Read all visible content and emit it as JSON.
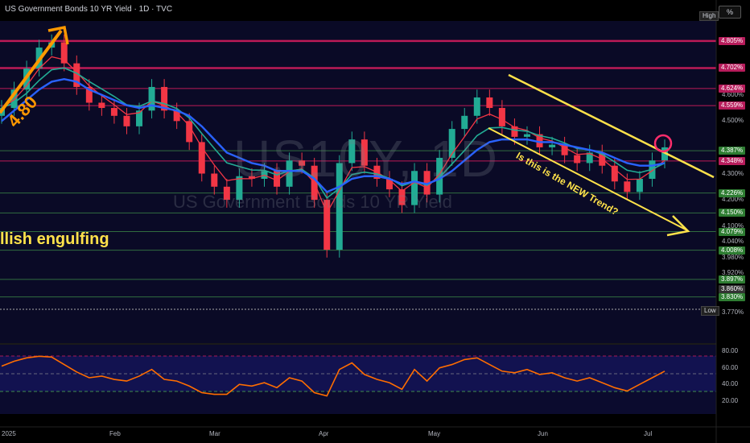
{
  "header": {
    "title": "US Government Bonds 10 YR Yield · 1D · TVC"
  },
  "toolbar": {
    "scale_label": "%",
    "high_label": "High",
    "low_label": "Low"
  },
  "watermark": {
    "symbol": "US10Y, 1D",
    "name": "US Government Bonds 10 YR Yield"
  },
  "annotations": {
    "trend_question": "Is this is the NEW Trend?",
    "pattern": "llish engulfing",
    "level_label": "4.80"
  },
  "colors": {
    "up": "#22ab94",
    "down": "#f23645",
    "ema_fast": "#f23645",
    "ema_mid": "#22ab94",
    "ema_slow": "#2962ff",
    "trendline": "#ffe24a",
    "level_magenta": "#e91e63",
    "level_green": "#4caf50",
    "rsi_line": "#ff6d00",
    "arrow_orange": "#ff9800"
  },
  "price_axis": [
    "4.600%",
    "4.500%",
    "4.300%",
    "4.200%",
    "4.100%",
    "4.040%",
    "3.980%",
    "3.920%",
    "3.770%"
  ],
  "rsi_axis": [
    "80.00",
    "60.00",
    "40.00",
    "20.00"
  ],
  "date_axis": [
    "2025",
    "Feb",
    "Mar",
    "Apr",
    "May",
    "Jun",
    "Jul"
  ],
  "price_tags": [
    {
      "label": "4.805%",
      "price": 4.805,
      "color": "#b71c5b"
    },
    {
      "label": "4.702%",
      "price": 4.702,
      "color": "#b71c5b"
    },
    {
      "label": "4.624%",
      "price": 4.624,
      "color": "#b71c5b"
    },
    {
      "label": "4.559%",
      "price": 4.559,
      "color": "#b71c5b"
    },
    {
      "label": "4.387%",
      "price": 4.387,
      "color": "#2e7d32"
    },
    {
      "label": "4.348%",
      "price": 4.348,
      "color": "#b71c5b"
    },
    {
      "label": "4.226%",
      "price": 4.226,
      "color": "#2e7d32"
    },
    {
      "label": "4.150%",
      "price": 4.15,
      "color": "#2e7d32"
    },
    {
      "label": "4.079%",
      "price": 4.079,
      "color": "#2e7d32"
    },
    {
      "label": "4.008%",
      "price": 4.008,
      "color": "#2e7d32"
    },
    {
      "label": "3.897%",
      "price": 3.897,
      "color": "#2e7d32"
    },
    {
      "label": "3.860%",
      "price": 3.86,
      "color": "#333333"
    },
    {
      "label": "3.830%",
      "price": 3.83,
      "color": "#2e7d32"
    }
  ],
  "chart_data": {
    "type": "line",
    "title": "US Government Bonds 10 YR Yield · 1D · TVC",
    "ylim": [
      3.74,
      4.86
    ],
    "x": [
      "Jan",
      "Jan",
      "Jan",
      "Jan",
      "Jan",
      "Jan",
      "Jan",
      "Jan",
      "Jan",
      "Feb",
      "Feb",
      "Feb",
      "Feb",
      "Feb",
      "Feb",
      "Feb",
      "Feb",
      "Mar",
      "Mar",
      "Mar",
      "Mar",
      "Mar",
      "Mar",
      "Mar",
      "Mar",
      "Mar",
      "Apr",
      "Apr",
      "Apr",
      "Apr",
      "Apr",
      "Apr",
      "Apr",
      "Apr",
      "Apr",
      "May",
      "May",
      "May",
      "May",
      "May",
      "May",
      "May",
      "May",
      "May",
      "Jun",
      "Jun",
      "Jun",
      "Jun",
      "Jun",
      "Jun",
      "Jun",
      "Jun",
      "Jul",
      "Jul"
    ],
    "series": [
      {
        "values": [
          4.55,
          4.62,
          4.7,
          4.78,
          4.8,
          4.72,
          4.63,
          4.57,
          4.55,
          4.52,
          4.48,
          4.54,
          4.63,
          4.54,
          4.5,
          4.42,
          4.3,
          4.25,
          4.2,
          4.29,
          4.28,
          4.31,
          4.25,
          4.35,
          4.33,
          4.2,
          4.01,
          4.34,
          4.43,
          4.33,
          4.28,
          4.24,
          4.18,
          4.31,
          4.22,
          4.36,
          4.47,
          4.52,
          4.59,
          4.55,
          4.48,
          4.44,
          4.45,
          4.4,
          4.41,
          4.37,
          4.34,
          4.38,
          4.33,
          4.27,
          4.23,
          4.28,
          4.35,
          4.4
        ]
      },
      {
        "values": [
          4.5,
          4.54,
          4.58,
          4.62,
          4.65,
          4.66,
          4.65,
          4.62,
          4.6,
          4.58,
          4.56,
          4.55,
          4.56,
          4.55,
          4.54,
          4.52,
          4.48,
          4.43,
          4.38,
          4.36,
          4.34,
          4.33,
          4.31,
          4.31,
          4.31,
          4.28,
          4.23,
          4.25,
          4.28,
          4.29,
          4.29,
          4.28,
          4.26,
          4.27,
          4.26,
          4.28,
          4.31,
          4.35,
          4.39,
          4.42,
          4.43,
          4.43,
          4.43,
          4.42,
          4.42,
          4.41,
          4.4,
          4.39,
          4.38,
          4.36,
          4.34,
          4.33,
          4.33,
          4.34
        ]
      }
    ]
  },
  "rsi_data": [
    62,
    68,
    72,
    74,
    73,
    64,
    55,
    48,
    50,
    46,
    44,
    50,
    58,
    46,
    44,
    38,
    30,
    28,
    28,
    40,
    38,
    42,
    36,
    48,
    44,
    30,
    26,
    58,
    66,
    52,
    46,
    42,
    34,
    58,
    44,
    60,
    64,
    70,
    72,
    64,
    56,
    54,
    58,
    52,
    54,
    48,
    44,
    48,
    42,
    36,
    32,
    40,
    48,
    56
  ]
}
